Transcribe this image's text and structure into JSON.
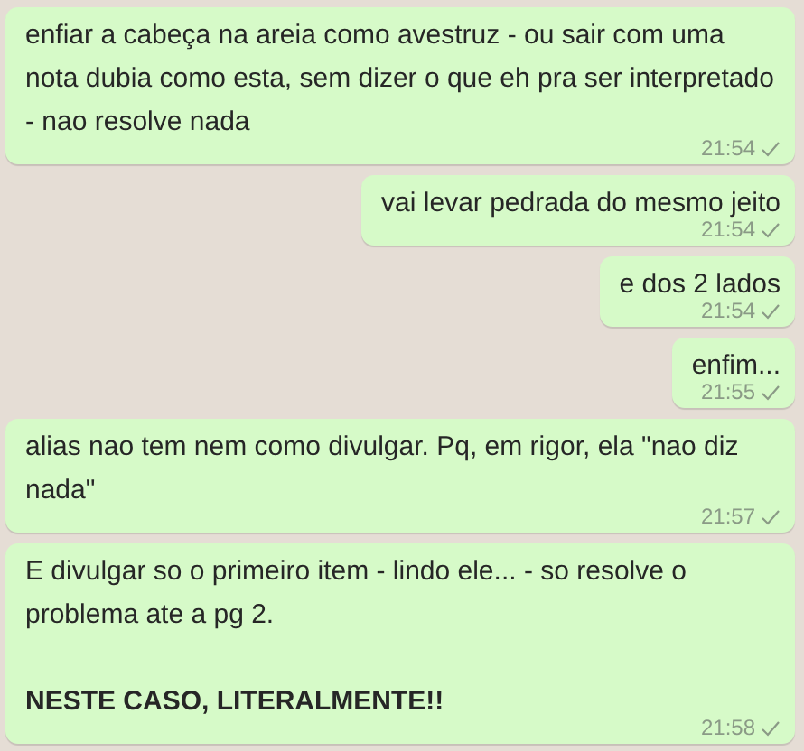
{
  "messages": [
    {
      "paragraphs": [
        "enfiar a cabeça na areia como avestruz - ou sair com uma nota dubia como esta, sem dizer o que eh pra ser interpretado - nao resolve nada"
      ],
      "time": "21:54",
      "read": false
    },
    {
      "paragraphs": [
        "vai levar pedrada do mesmo jeito"
      ],
      "time": "21:54",
      "read": false
    },
    {
      "paragraphs": [
        "e dos 2 lados"
      ],
      "time": "21:54",
      "read": false
    },
    {
      "paragraphs": [
        "enfim..."
      ],
      "time": "21:55",
      "read": false
    },
    {
      "paragraphs": [
        "alias nao tem nem como divulgar. Pq, em rigor, ela \"nao diz nada\""
      ],
      "time": "21:57",
      "read": false
    },
    {
      "paragraphs": [
        "E divulgar so o primeiro item - lindo ele... - so resolve o problema ate a pg 2.",
        "**NESTE CASO, LITERALMENTE!!**"
      ],
      "time": "21:58",
      "read": false
    }
  ]
}
